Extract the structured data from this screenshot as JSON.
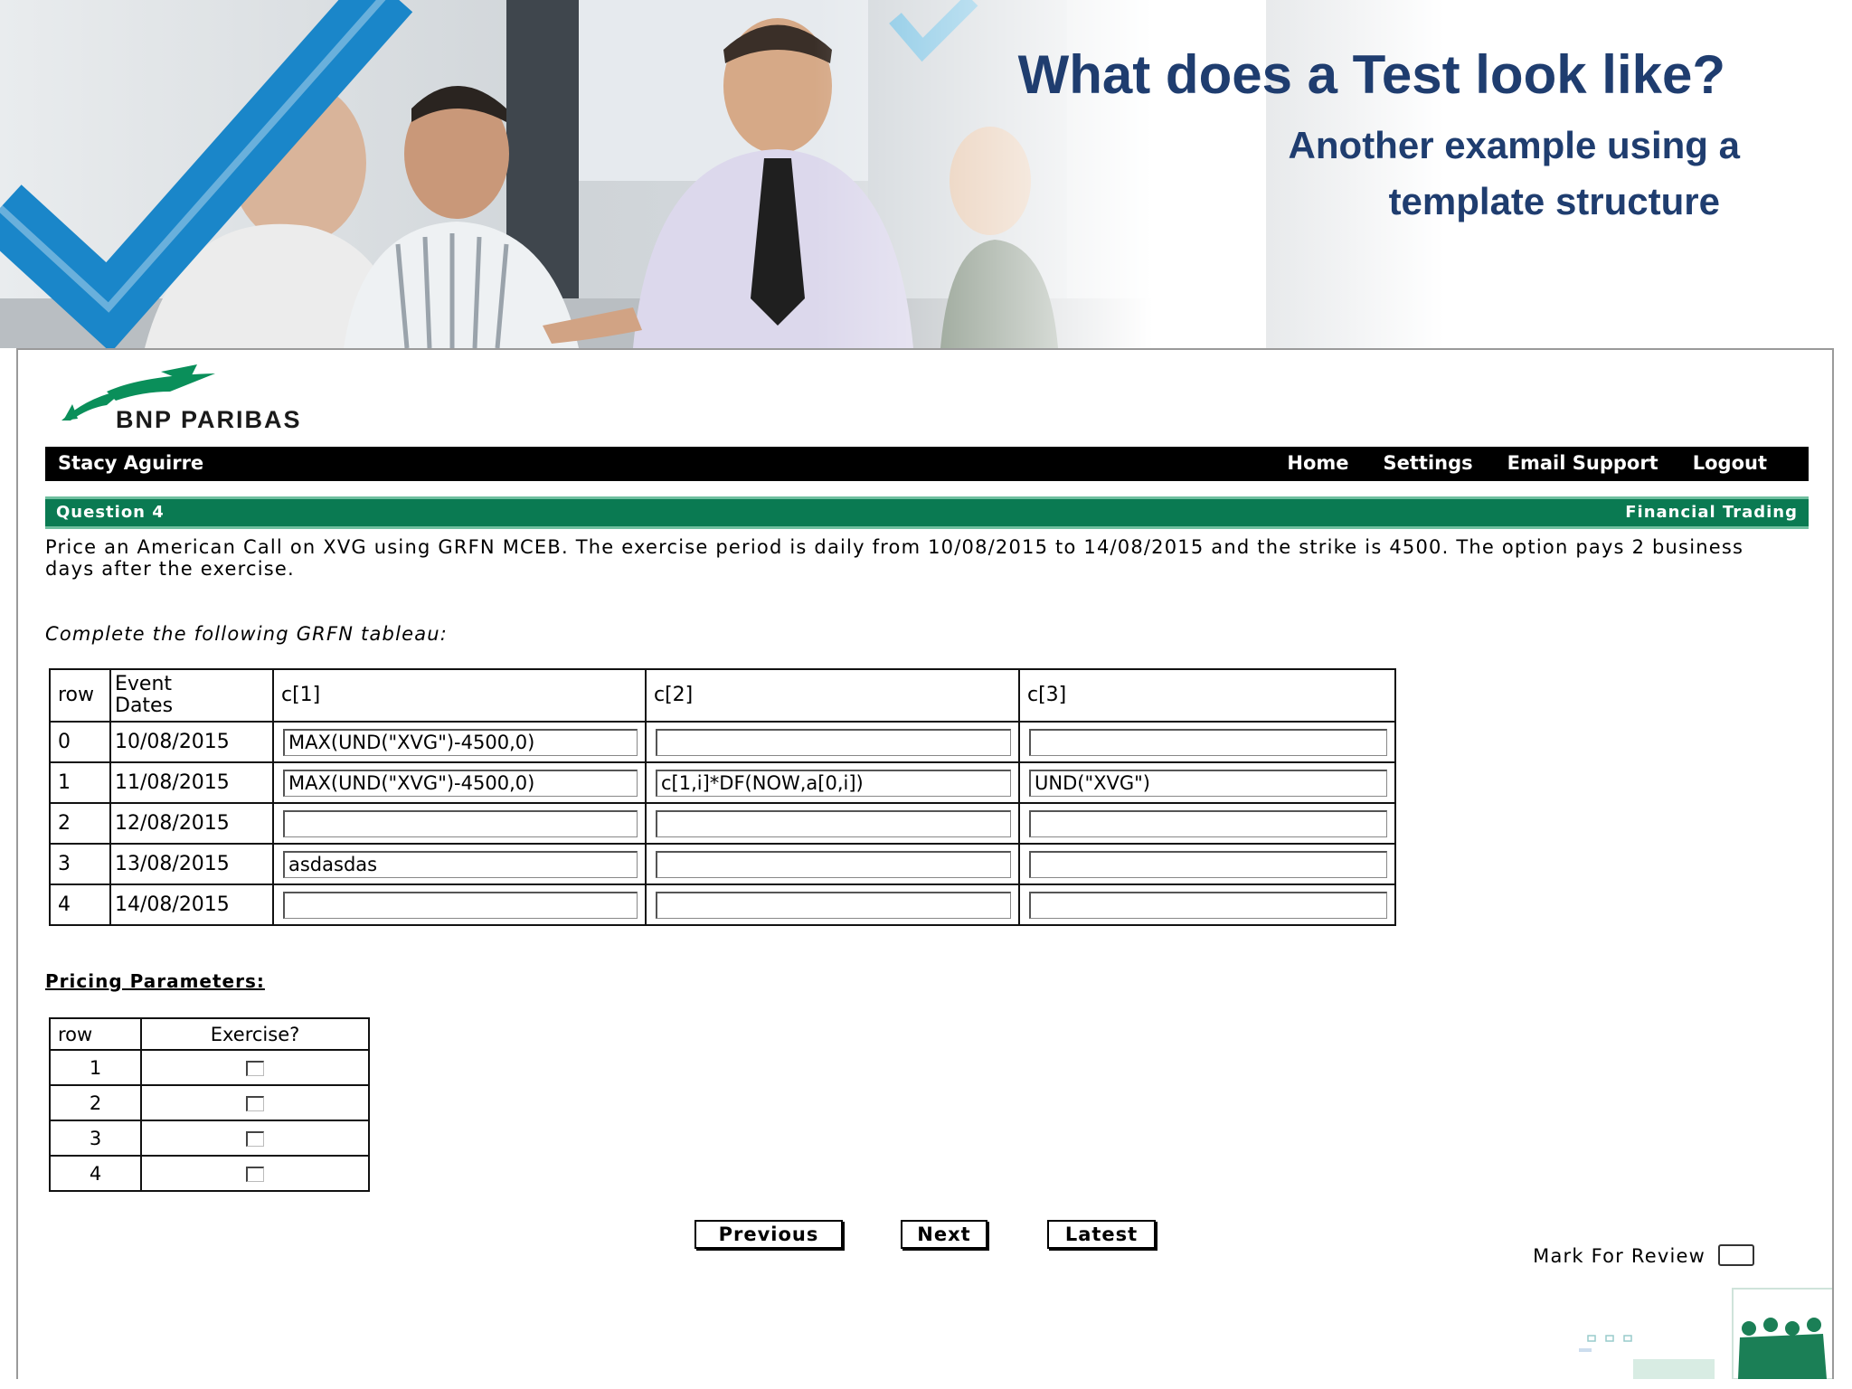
{
  "slide": {
    "title": "What does a Test look like?",
    "subtitle_line1": "Another example using a",
    "subtitle_line2": "template structure"
  },
  "app": {
    "brand": "BNP PARIBAS",
    "user_name": "Stacy Aguirre",
    "nav": [
      "Home",
      "Settings",
      "Email Support",
      "Logout"
    ],
    "question_label": "Question 4",
    "category": "Financial Trading",
    "prompt": "Price an American Call on XVG using GRFN MCEB. The exercise period is daily from 10/08/2015 to 14/08/2015 and the strike is 4500. The option pays 2 business days after the exercise.",
    "instruction": "Complete the following GRFN tableau:",
    "tableau": {
      "headers": [
        "row",
        "Event Dates",
        "c[1]",
        "c[2]",
        "c[3]"
      ],
      "rows": [
        {
          "row": "0",
          "date": "10/08/2015",
          "c1": "MAX(UND(\"XVG\")-4500,0)",
          "c2": "",
          "c3": ""
        },
        {
          "row": "1",
          "date": "11/08/2015",
          "c1": "MAX(UND(\"XVG\")-4500,0)",
          "c2": "c[1,i]*DF(NOW,a[0,i])",
          "c3": "UND(\"XVG\")"
        },
        {
          "row": "2",
          "date": "12/08/2015",
          "c1": "",
          "c2": "",
          "c3": ""
        },
        {
          "row": "3",
          "date": "13/08/2015",
          "c1": "asdasdas",
          "c2": "",
          "c3": ""
        },
        {
          "row": "4",
          "date": "14/08/2015",
          "c1": "",
          "c2": "",
          "c3": ""
        }
      ]
    },
    "pricing": {
      "title": "Pricing Parameters:",
      "headers": [
        "row",
        "Exercise?"
      ],
      "rows": [
        "1",
        "2",
        "3",
        "4"
      ]
    },
    "buttons": {
      "previous": "Previous",
      "next": "Next",
      "latest": "Latest"
    },
    "mark_for_review": "Mark For Review"
  },
  "colors": {
    "title_blue": "#1f3d6f",
    "question_bar_green": "#0a7a52",
    "logo_green": "#0a8f5a",
    "checkmark_blue": "#1e88c8"
  }
}
